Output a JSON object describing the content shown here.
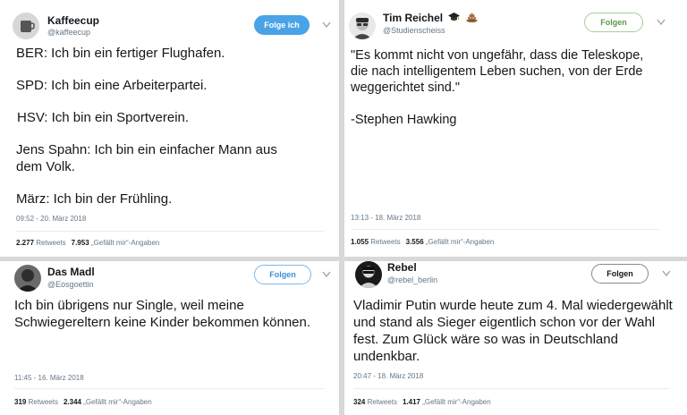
{
  "tweets": [
    {
      "name": "Kaffeecup",
      "handle": "@kaffeecup",
      "follow_label": "Folge ich",
      "text_lines": [
        "BER: Ich bin ein fertiger Flughafen.",
        "",
        "SPD: Ich bin eine Arbeiterpartei.",
        "",
        "HSV: Ich bin ein Sportverein.",
        "",
        "Jens Spahn: Ich bin ein einfacher Mann aus dem Volk.",
        "",
        "März: Ich bin der Frühling."
      ],
      "timestamp": "09:52 - 20. März 2018",
      "retweets": "2.277",
      "retweets_label": "Retweets",
      "likes": "7.953",
      "likes_label": "„Gefällt mir“-Angaben"
    },
    {
      "name": "Tim Reichel",
      "handle": "@Studienscheiss",
      "name_icons": [
        "graduation-cap",
        "pile-of-poo"
      ],
      "follow_label": "Folgen",
      "text": "\"Es kommt nicht von ungefähr, dass die Teleskope, die nach intelligentem Leben suchen, von der Erde weggerichtet sind.\"\n\n-Stephen Hawking",
      "timestamp": "13:13 - 18. März 2018",
      "retweets": "1.055",
      "retweets_label": "Retweets",
      "likes": "3.556",
      "likes_label": "„Gefällt mir“-Angaben"
    },
    {
      "name": "Das Madl",
      "handle": "@Eosgoettin",
      "follow_label": "Folgen",
      "text": "Ich bin übrigens nur Single, weil meine Schwiegereltern keine Kinder bekommen können.",
      "timestamp": "11:45 - 16. März 2018",
      "retweets": "319",
      "retweets_label": "Retweets",
      "likes": "2.344",
      "likes_label": "„Gefällt mir“-Angaben"
    },
    {
      "name": "Rebel",
      "handle": "@rebel_berlin",
      "follow_label": "Folgen",
      "text": "Vladimir Putin wurde heute zum 4. Mal wiedergewählt und stand als Sieger eigentlich schon vor der Wahl fest. Zum Glück wäre so was in Deutschland undenkbar.",
      "timestamp": "20:47 - 18. März 2018",
      "retweets": "324",
      "retweets_label": "Retweets",
      "likes": "1.417",
      "likes_label": "„Gefällt mir“-Angaben"
    }
  ],
  "colors": {
    "divider": "#d8d8d8",
    "follow_filled": "#4aa3e6",
    "secondary_text": "#657786"
  }
}
